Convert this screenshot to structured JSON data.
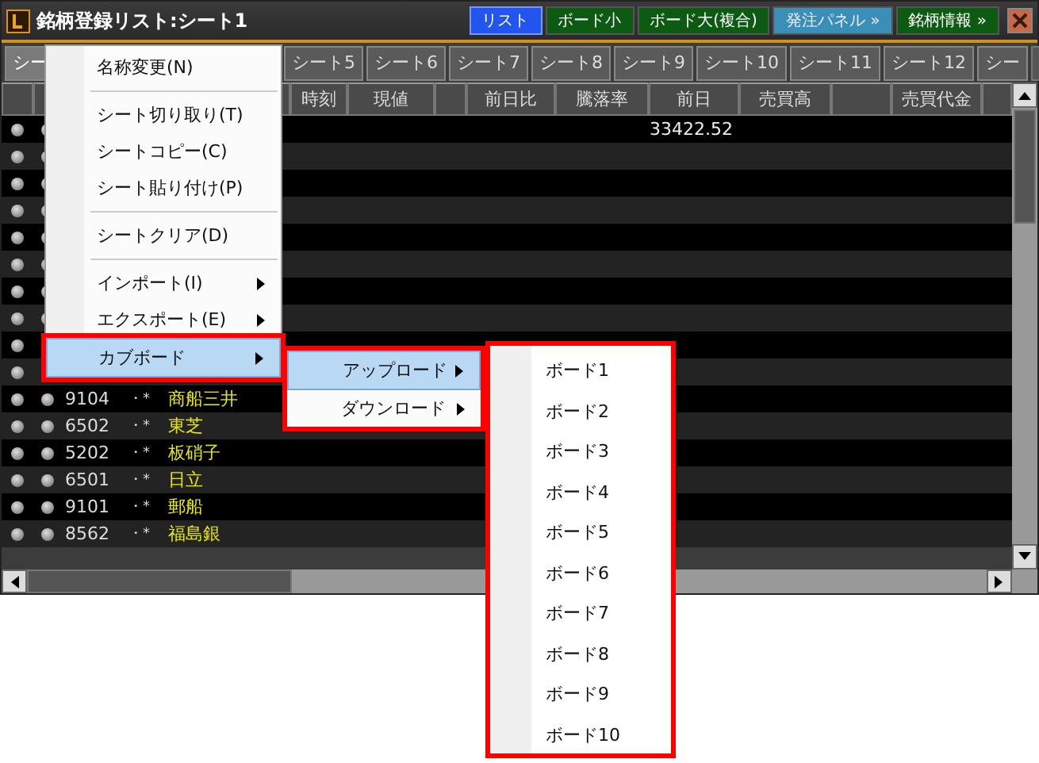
{
  "title_bar": {
    "title": "銘柄登録リスト:シート1",
    "buttons": [
      {
        "label": "リスト",
        "kind": "list",
        "selected": true
      },
      {
        "label": "ボード小",
        "kind": "board",
        "selected": false
      },
      {
        "label": "ボード大(複合)",
        "kind": "board",
        "selected": false
      },
      {
        "label": "発注パネル »",
        "kind": "order",
        "selected": false
      },
      {
        "label": "銘柄情報 »",
        "kind": "board",
        "selected": false
      }
    ]
  },
  "sheet_tabs": [
    {
      "label": "シー",
      "selected": true
    },
    {
      "label": "シート5",
      "selected": false
    },
    {
      "label": "シート6",
      "selected": false
    },
    {
      "label": "シート7",
      "selected": false
    },
    {
      "label": "シート8",
      "selected": false
    },
    {
      "label": "シート9",
      "selected": false
    },
    {
      "label": "シート10",
      "selected": false
    },
    {
      "label": "シート11",
      "selected": false
    },
    {
      "label": "シート12",
      "selected": false
    },
    {
      "label": "シー",
      "selected": false
    }
  ],
  "table": {
    "columns": [
      "時刻",
      "現値",
      "前日比",
      "騰落率",
      "前日",
      "売買高",
      "売買代金"
    ],
    "rows": [
      {
        "prev": "33422.52"
      },
      {},
      {},
      {},
      {},
      {},
      {},
      {},
      {},
      {},
      {
        "code": "9104",
        "mark": "・*",
        "name": "商船三井"
      },
      {
        "code": "6502",
        "mark": "・*",
        "name": "東芝"
      },
      {
        "code": "5202",
        "mark": "・*",
        "name": "板硝子"
      },
      {
        "code": "6501",
        "mark": "・*",
        "name": "日立"
      },
      {
        "code": "9101",
        "mark": "・*",
        "name": "郵船"
      },
      {
        "code": "8562",
        "mark": "・*",
        "name": "福島銀"
      }
    ]
  },
  "context_menu": {
    "items": [
      {
        "kind": "item",
        "label": "名称変更(N)",
        "submenu": false,
        "selected": false
      },
      {
        "kind": "separator"
      },
      {
        "kind": "item",
        "label": "シート切り取り(T)",
        "submenu": false,
        "selected": false
      },
      {
        "kind": "item",
        "label": "シートコピー(C)",
        "submenu": false,
        "selected": false
      },
      {
        "kind": "item",
        "label": "シート貼り付け(P)",
        "submenu": false,
        "selected": false
      },
      {
        "kind": "separator"
      },
      {
        "kind": "item",
        "label": "シートクリア(D)",
        "submenu": false,
        "selected": false
      },
      {
        "kind": "separator"
      },
      {
        "kind": "item",
        "label": "インポート(I)",
        "submenu": true,
        "selected": false
      },
      {
        "kind": "item",
        "label": "エクスポート(E)",
        "submenu": true,
        "selected": false
      },
      {
        "kind": "item",
        "label": "カブボード",
        "submenu": true,
        "selected": true
      }
    ]
  },
  "submenu": {
    "items": [
      {
        "label": "アップロード",
        "submenu": true,
        "selected": true
      },
      {
        "label": "ダウンロード",
        "submenu": true,
        "selected": false
      }
    ]
  },
  "board_menu": {
    "items": [
      "ボード1",
      "ボード2",
      "ボード3",
      "ボード4",
      "ボード5",
      "ボード6",
      "ボード7",
      "ボード8",
      "ボード9",
      "ボード10"
    ]
  }
}
